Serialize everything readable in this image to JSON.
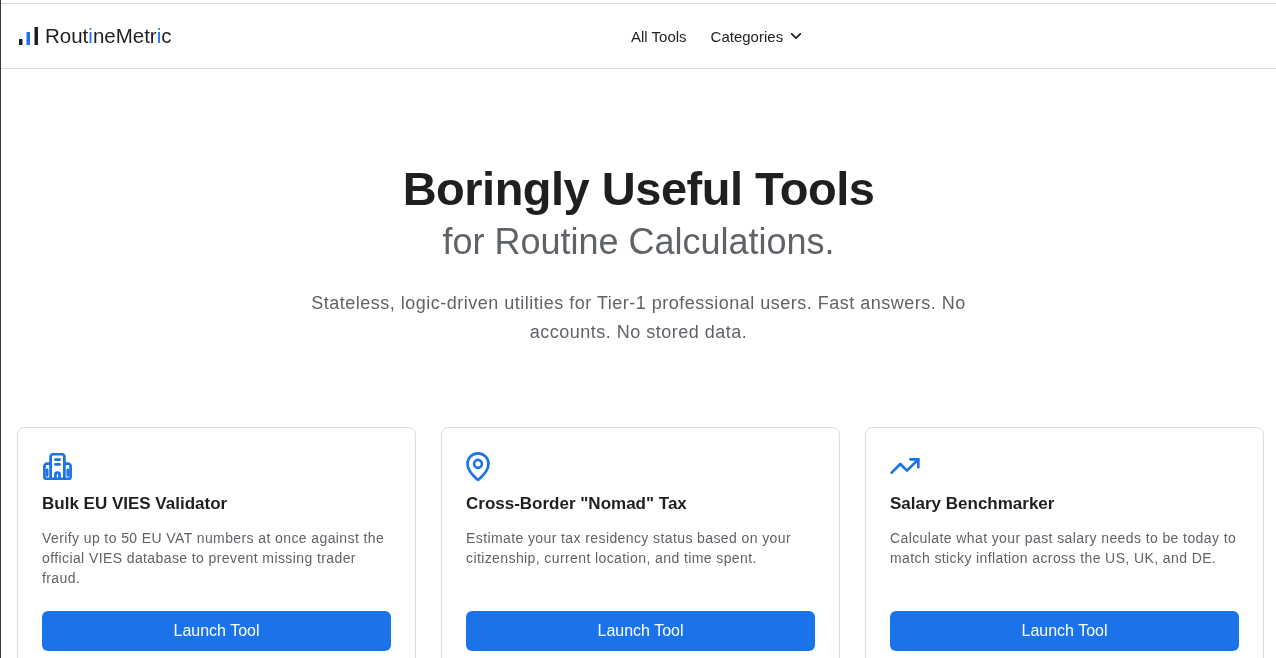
{
  "header": {
    "logo": {
      "parts": [
        {
          "text": "Rout",
          "accent": false
        },
        {
          "text": "i",
          "accent": true
        },
        {
          "text": "neMetr",
          "accent": false
        },
        {
          "text": "i",
          "accent": true
        },
        {
          "text": "c",
          "accent": false
        }
      ]
    },
    "nav": [
      {
        "label": "All Tools",
        "kind": "link"
      },
      {
        "label": "Categories",
        "kind": "dropdown",
        "expanded": false
      }
    ]
  },
  "hero": {
    "title": "Boringly Useful Tools",
    "subtitle": "for Routine Calculations.",
    "description": "Stateless, logic-driven utilities for Tier-1 professional users. Fast answers. No accounts. No stored data."
  },
  "tools": [
    {
      "title": "Bulk EU VIES Validator",
      "description": "Verify up to 50 EU VAT numbers at once against the official VIES database to prevent missing trader fraud.",
      "button": "Launch Tool"
    },
    {
      "title": "Cross-Border \"Nomad\" Tax",
      "description": "Estimate your tax residency status based on your citizenship, current location, and time spent.",
      "button": "Launch Tool"
    },
    {
      "title": "Salary Benchmarker",
      "description": "Calculate what your past salary needs to be today to match sticky inflation across the US, UK, and DE.",
      "button": "Launch Tool"
    }
  ]
}
